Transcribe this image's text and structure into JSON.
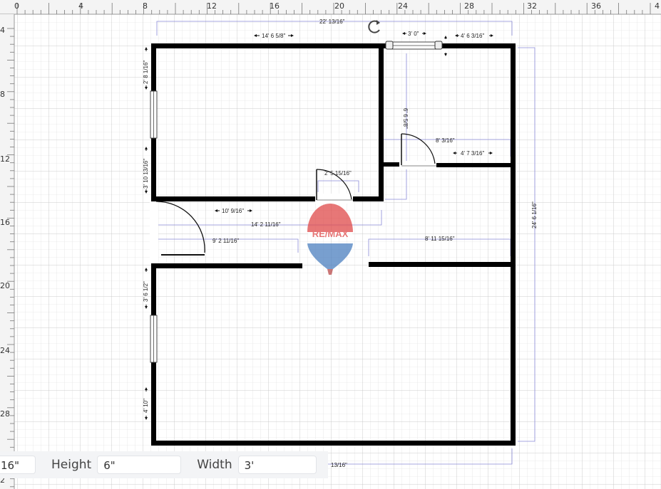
{
  "ruler": {
    "top_ticks": [
      "0",
      "4",
      "8",
      "12",
      "16",
      "20",
      "24",
      "28",
      "32",
      "36",
      "4"
    ],
    "left_ticks": [
      "4",
      "8",
      "12",
      "16",
      "20",
      "24",
      "28",
      "2"
    ]
  },
  "dimensions": {
    "overall_top": "22' 13/16\"",
    "top_left_wall": "14' 6 5/8\"",
    "window_top": "3' 0\"",
    "top_right_segment": "4' 6 3/16\"",
    "left_window_upper": "2' 8 1/16\"",
    "left_upper_lower": "3' 10 13/16\"",
    "vertical_closet": "6' 6 5/8\"",
    "closet_width": "8' 3/16\"",
    "closet_right": "4' 7 3/16\"",
    "door_small": "2' 5 15/16\"",
    "hall_wall": "10' 9/16\"",
    "hall_total": "14' 2 11/16\"",
    "hall_lower": "9' 2 11/16\"",
    "right_room": "8' 11 15/16\"",
    "overall_right": "24' 6 1/16\"",
    "left_window_lower": "3' 6 1/2\"",
    "left_bottom": "4' 10\"",
    "bottom_partial": "13/16\""
  },
  "logo": {
    "text": "RE/MAX"
  },
  "properties": {
    "first_value": "16\"",
    "height_label": "Height",
    "height_value": "6\"",
    "width_label": "Width",
    "width_value": "3'"
  }
}
